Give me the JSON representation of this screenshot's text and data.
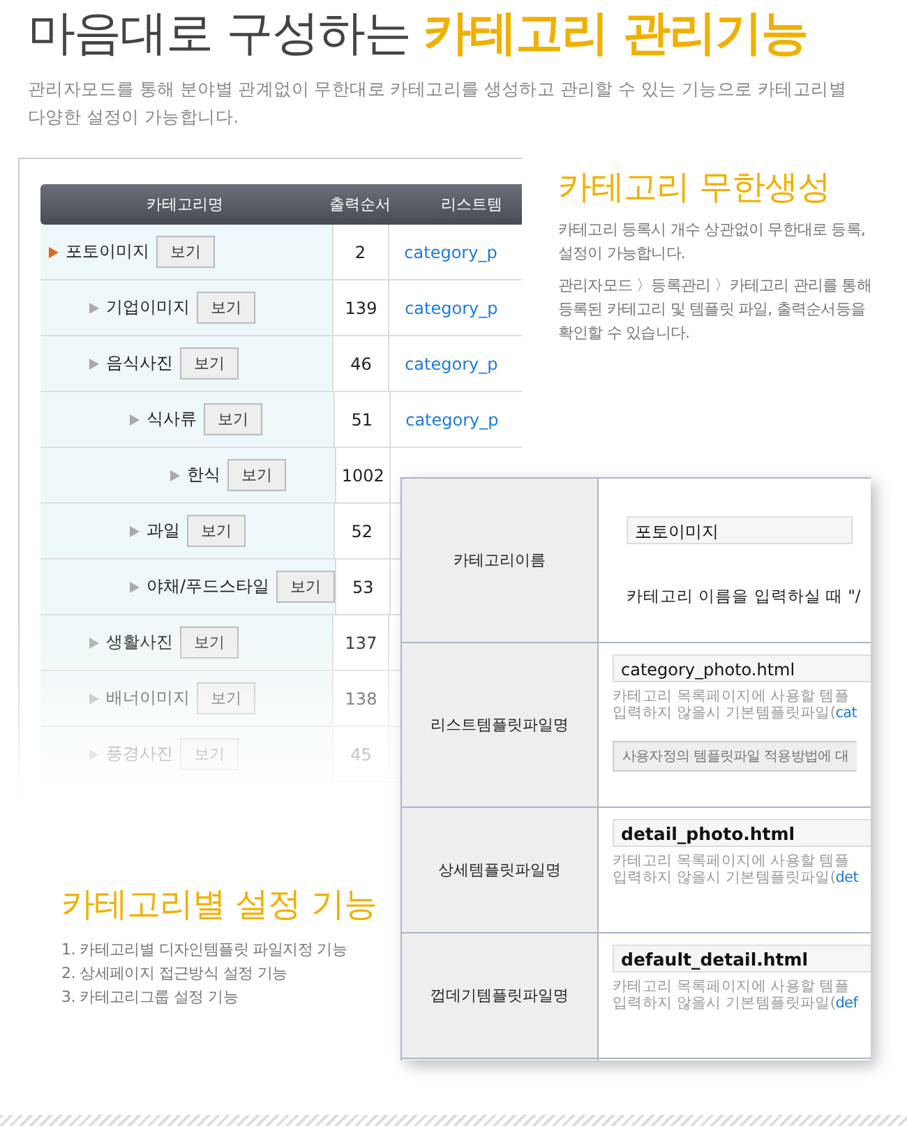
{
  "header": {
    "title_plain": "마음대로 구성하는",
    "title_highlight": "카테고리 관리기능",
    "description_lines": [
      "관리자모드를 통해 분야별 관계없이 무한대로 카테고리를 생성하고 관리할 수 있는 기능으로 카테고리별",
      "다양한 설정이 가능합니다."
    ]
  },
  "category_list": {
    "columns": [
      "카테고리명",
      "출력순서",
      "리스트템"
    ],
    "rows": [
      {
        "name": "포토이미지",
        "button": "보기",
        "order": "2",
        "list_template": "category_p",
        "selected": true,
        "children": [
          {
            "name": "기업이미지",
            "button": "보기",
            "order": "139",
            "list_template": "category_p",
            "selected": false
          },
          {
            "name": "음식사진",
            "button": "보기",
            "order": "46",
            "list_template": "category_p",
            "selected": false,
            "children": [
              {
                "name": "식사류",
                "button": "보기",
                "order": "51",
                "list_template": "category_p",
                "selected": false,
                "children": [
                  {
                    "name": "한식",
                    "button": "보기",
                    "order": "1002",
                    "selected": false
                  }
                ]
              },
              {
                "name": "과일",
                "button": "보기",
                "order": "52",
                "selected": false
              },
              {
                "name": "야채/푸드스타일",
                "button": "보기",
                "order": "53",
                "selected": false
              }
            ]
          },
          {
            "name": "생활사진",
            "button": "보기",
            "order": "137",
            "selected": false
          },
          {
            "name": "배너이미지",
            "button": "보기",
            "order": "138",
            "selected": false
          },
          {
            "name": "풍경사진",
            "button": "보기",
            "order": "45",
            "selected": false
          }
        ]
      }
    ]
  },
  "feature_unlimited": {
    "title": "카테고리 무한생성",
    "paragraphs": [
      [
        "카테고리 등록시 개수 상관없이 무한대로 등록,",
        "설정이 가능합니다."
      ],
      [
        "관리자모드 〉등록관리 〉카테고리 관리를 통해",
        "등록된 카테고리 및 템플릿 파일, 출력순서등을",
        "확인할 수 있습니다."
      ]
    ]
  },
  "settings_form": {
    "rows": [
      {
        "kind": "name",
        "label": "카테고리이름",
        "value": "포토이미지",
        "hint": "카테고리 이름을 입력하실 때 \"/"
      },
      {
        "kind": "template",
        "label": "리스트템플릿파일명",
        "value": "category_photo.html",
        "bold": false,
        "hint_lines": [
          "카테고리 목록페이지에 사용할 템플",
          "입력하지 않을시 기본템플릿파일("
        ],
        "hint_link": "cat",
        "button": "사용자정의 템플릿파일 적용방법에 대"
      },
      {
        "kind": "template",
        "label": "상세템플릿파일명",
        "value": "detail_photo.html",
        "bold": true,
        "hint_lines": [
          "카테고리 목록페이지에 사용할 템플",
          "입력하지 않을시 기본템플릿파일("
        ],
        "hint_link": "det"
      },
      {
        "kind": "template",
        "label": "껍데기템플릿파일명",
        "value": "default_detail.html",
        "bold": true,
        "hint_lines": [
          "카테고리 목록페이지에 사용할 템플",
          "입력하지 않을시 기본템플릿파일("
        ],
        "hint_link": "def"
      }
    ]
  },
  "feature_settings": {
    "title": "카테고리별 설정 기능",
    "items": [
      "1. 카테고리별 디자인템플릿 파일지정 기능",
      "2. 상세페이지 접근방식 설정 기능",
      "3. 카테고리그룹 설정 기능"
    ]
  }
}
